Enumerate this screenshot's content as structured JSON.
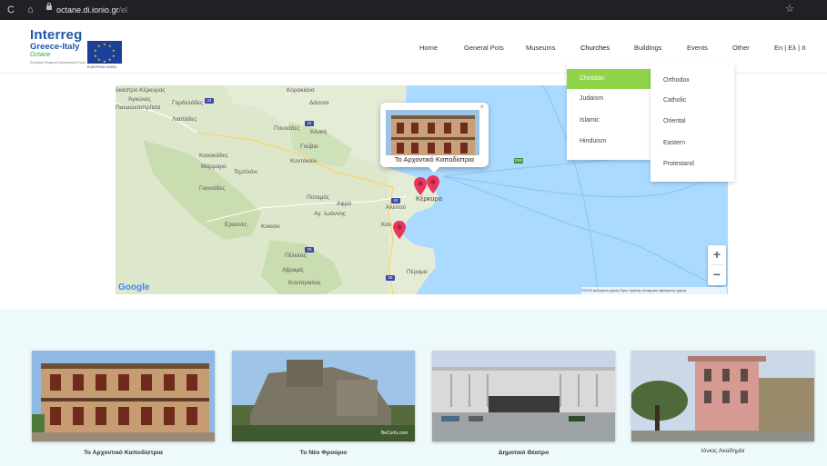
{
  "browser": {
    "url_host": "octane.di.ionio.gr",
    "url_path": "/el"
  },
  "logo": {
    "line1": "Interreg",
    "line2": "Greece-Italy",
    "line3": "Octane",
    "line4": "European Regional Development Fund",
    "eu_label": "EUROPEAN UNION"
  },
  "nav": {
    "items": [
      "Home",
      "General PoIs",
      "Museums",
      "Churches",
      "Buildings",
      "Events",
      "Other"
    ],
    "lang": "En | Ελ | It"
  },
  "dropdown_primary": {
    "items": [
      "Christian",
      "Judaism",
      "Islamic",
      "Hinduism"
    ],
    "highlight_color": "#8fd44a"
  },
  "dropdown_secondary": {
    "items": [
      "Orthodox",
      "Catholic",
      "Oriental",
      "Eastern",
      "Protestand"
    ]
  },
  "map": {
    "labels": [
      "όκαστρο Κέρκυρας",
      "Κορακιάνα",
      "Άγκώνες",
      "Γαρδελάδες",
      "Δάσσια",
      "Παλαιοκαστρίτσα",
      "Λιαπάδες",
      "Πουλάδες",
      "Άλυκή",
      "Γούβια",
      "Κανακάδες",
      "Κοντόκαλι",
      "Μάρμαρο",
      "Τεμπλόνι",
      "Γιαννάδες",
      "Ποταμός",
      "Αφρά",
      "Αλεπού",
      "Αγ. Ιωάννης",
      "Κέρκυρα",
      "Εραονες",
      "Κοκκίνι",
      "Καν",
      "Πέλεκας",
      "Αβραμίς",
      "Πέραμα",
      "Κοντογιαλος"
    ],
    "road_numbers": [
      "24",
      "24",
      "24",
      "25",
      "25",
      "E55"
    ],
    "google": "Google",
    "attribution": "©2019 Δεδομένα χάρτη   Όροι Χρήσης   Αναφορά σφάλματος χάρτη",
    "zoom_in": "+",
    "zoom_out": "−",
    "popup_caption": "Το Αρχοντικό Καποδίστρια",
    "popup_close": "×",
    "marker_color": "#e8365d",
    "sea_color": "#aadaff",
    "land_color": "#e8efd9"
  },
  "cards": [
    {
      "caption": "Το Αρχοντικό Καποδίστρια"
    },
    {
      "caption": "Το Νέο Φρούριο"
    },
    {
      "caption": "Δημοτικό Θέατρο"
    },
    {
      "caption": "Ιόνιος Ακαδημία"
    }
  ],
  "card_watermark": "BeCorfu.com",
  "icons": {
    "reload": "reload-icon",
    "home": "home-icon",
    "lock": "lock-icon",
    "bookmark": "star-icon"
  }
}
